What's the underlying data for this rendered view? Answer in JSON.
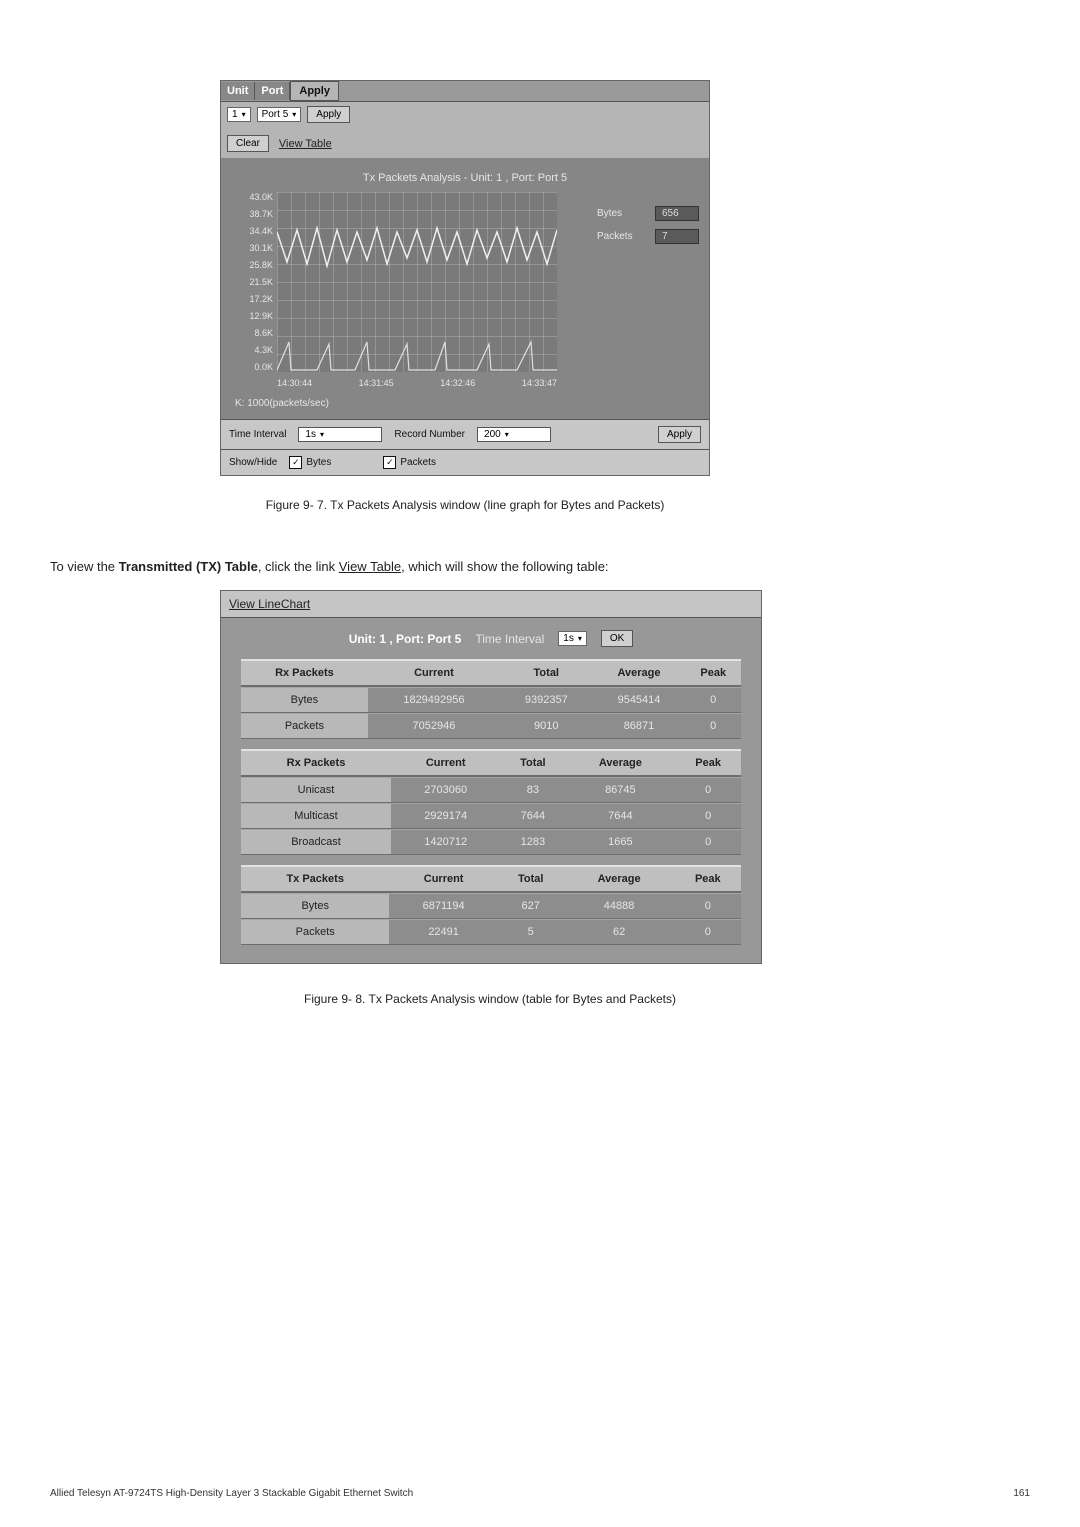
{
  "fig1": {
    "header": {
      "unit": "Unit",
      "port": "Port",
      "apply": "Apply",
      "unit_select_value": "1",
      "port_select_value": "Port 5",
      "apply_btn": "Apply",
      "clear_btn": "Clear",
      "view_table_link": "View Table"
    },
    "chart_title": "Tx Packets Analysis - Unit: 1 , Port: Port 5",
    "yticks": [
      "43.0K",
      "38.7K",
      "34.4K",
      "30.1K",
      "25.8K",
      "21.5K",
      "17.2K",
      "12.9K",
      "8.6K",
      "4.3K",
      "0.0K"
    ],
    "xticks": [
      "14:30:44",
      "14:31:45",
      "14:32:46",
      "14:33:47"
    ],
    "side": {
      "bytes_label": "Bytes",
      "bytes_value": "656",
      "packets_label": "Packets",
      "packets_value": "7"
    },
    "k_note": "K: 1000(packets/sec)",
    "controls": {
      "time_interval_label": "Time Interval",
      "time_interval_value": "1s",
      "record_number_label": "Record Number",
      "record_number_value": "200",
      "apply_btn": "Apply",
      "showhide_label": "Show/Hide",
      "bytes_chk": "Bytes",
      "packets_chk": "Packets"
    }
  },
  "caption1": "Figure 9- 7. Tx Packets Analysis window (line graph for Bytes and Packets)",
  "bodytext_pre": "To view the ",
  "bodytext_bold": "Transmitted (TX) Table",
  "bodytext_mid": ", click the link ",
  "bodytext_link": "View Table",
  "bodytext_post": ", which will show the following table:",
  "fig2": {
    "top_label": "View LineChart",
    "titlebar_label": "Unit: 1 , Port: Port 5",
    "titlebar_ti": "Time Interval",
    "titlebar_ti_value": "1s",
    "titlebar_ok": "OK",
    "tables": [
      {
        "head": [
          "Rx Packets",
          "Current",
          "Total",
          "Average",
          "Peak"
        ],
        "rows": [
          [
            "Bytes",
            "1829492956",
            "9392357",
            "9545414",
            "0"
          ],
          [
            "Packets",
            "7052946",
            "9010",
            "86871",
            "0"
          ]
        ]
      },
      {
        "head": [
          "Rx Packets",
          "Current",
          "Total",
          "Average",
          "Peak"
        ],
        "rows": [
          [
            "Unicast",
            "2703060",
            "83",
            "86745",
            "0"
          ],
          [
            "Multicast",
            "2929174",
            "7644",
            "7644",
            "0"
          ],
          [
            "Broadcast",
            "1420712",
            "1283",
            "1665",
            "0"
          ]
        ]
      },
      {
        "head": [
          "Tx Packets",
          "Current",
          "Total",
          "Average",
          "Peak"
        ],
        "rows": [
          [
            "Bytes",
            "6871194",
            "627",
            "44888",
            "0"
          ],
          [
            "Packets",
            "22491",
            "5",
            "62",
            "0"
          ]
        ]
      }
    ]
  },
  "caption2": "Figure 9- 8. Tx Packets Analysis window (table for Bytes and Packets)",
  "footer_left": "Allied Telesyn AT-9724TS High-Density Layer 3 Stackable Gigabit Ethernet Switch",
  "footer_right": "161",
  "chart_data": {
    "type": "line",
    "title": "Tx Packets Analysis - Unit: 1 , Port: Port 5",
    "x": [
      "14:30:44",
      "14:31:45",
      "14:32:46",
      "14:33:47"
    ],
    "ylim": [
      0,
      43000
    ],
    "ylabel": "packets/sec (K=1000)",
    "series": [
      {
        "name": "Bytes",
        "note": "upper trace ~656 current",
        "values_approx": "high amplitude oscillation near mid-upper band"
      },
      {
        "name": "Packets",
        "note": "lower spiky trace ~7 current",
        "values_approx": "near zero with periodic spikes"
      }
    ]
  }
}
